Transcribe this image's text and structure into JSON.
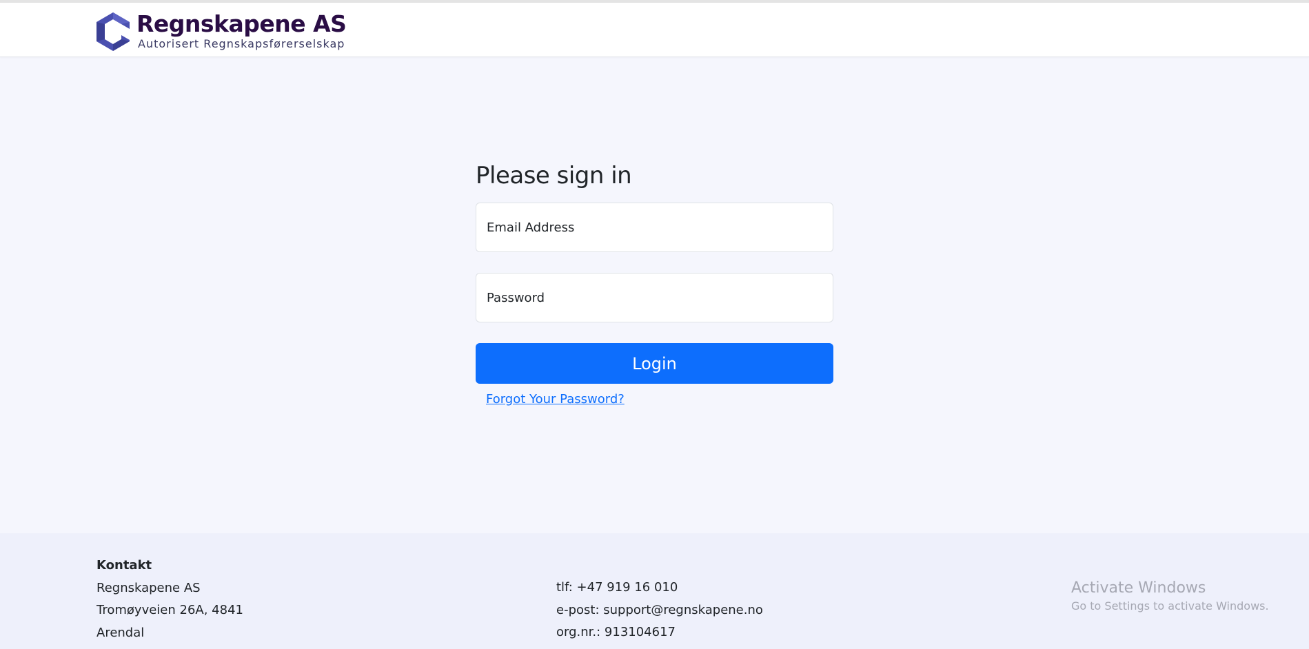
{
  "header": {
    "company_name": "Regnskapene AS",
    "company_subtitle": "Autorisert Regnskapsførerselskap",
    "logo_icon": "hexagon-logo-icon",
    "brand_colors": {
      "logo_light": "#5a60c0",
      "logo_dark": "#3a3f94",
      "name": "#2a0d45"
    }
  },
  "login": {
    "title": "Please sign in",
    "email_placeholder": "Email Address",
    "password_placeholder": "Password",
    "login_label": "Login",
    "forgot_label": "Forgot Your Password?"
  },
  "footer": {
    "title": "Kontakt",
    "address": [
      "Regnskapene AS",
      "Tromøyveien 26A, 4841",
      "Arendal"
    ],
    "contact": [
      "tlf: +47 919 16 010",
      "e-post: support@regnskapene.no",
      "org.nr.: 913104617"
    ]
  },
  "watermark": {
    "title": "Activate Windows",
    "subtitle": "Go to Settings to activate Windows."
  },
  "colors": {
    "accent": "#0d6efd",
    "background": "#f5f6fd",
    "footer_background": "#eef0fb"
  }
}
